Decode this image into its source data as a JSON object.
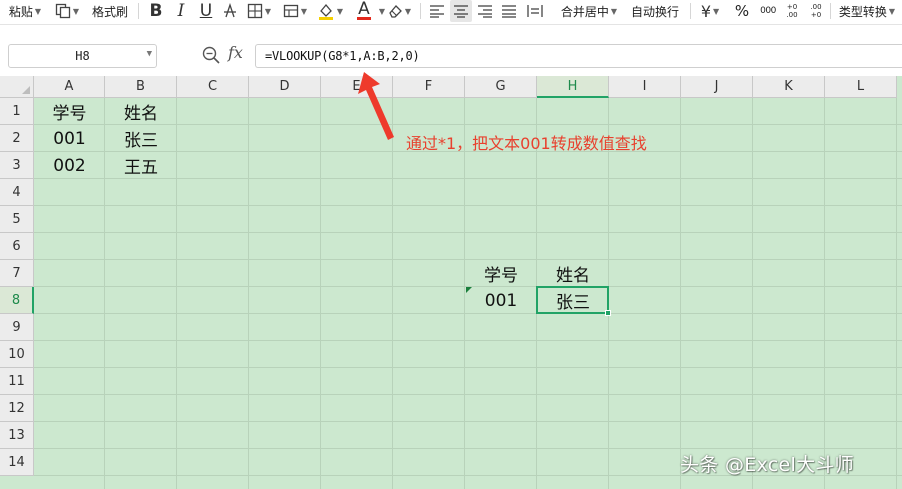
{
  "toolbar": {
    "paste_label": "粘贴",
    "format_painter_label": "格式刷",
    "bold_label": "B",
    "italic_label": "I",
    "underline_label": "U",
    "font_color_label": "A",
    "merge_center_label": "合并居中",
    "wrap_text_label": "自动换行",
    "currency_label": "¥",
    "percent_label": "%",
    "thousands_label": "000",
    "increase_decimal_label": "+0 .00",
    "decrease_decimal_label": ".00 +0",
    "type_convert_label": "类型转换",
    "font_color_hex": "#e3281c",
    "accent_hex": "#21a366"
  },
  "formula_bar": {
    "name_box": "H8",
    "fx_label": "fx",
    "formula": "=VLOOKUP(G8*1,A:B,2,0)"
  },
  "columns": [
    "A",
    "B",
    "C",
    "D",
    "E",
    "F",
    "G",
    "H",
    "I",
    "J",
    "K",
    "L"
  ],
  "rows": [
    "1",
    "2",
    "3",
    "4",
    "5",
    "6",
    "7",
    "8",
    "9",
    "10",
    "11",
    "12",
    "13",
    "14"
  ],
  "active_cell": {
    "column": "H",
    "row": "8"
  },
  "cells": {
    "A1": "学号",
    "B1": "姓名",
    "A2": "001",
    "B2": "张三",
    "A3": "002",
    "B3": "王五",
    "G7": "学号",
    "H7": "姓名",
    "G8": "001",
    "H8": "张三"
  },
  "annotation": {
    "text": "通过*1，把文本001转成数值查找",
    "color": "#e8412e"
  },
  "watermark": "头条 @Excel大斗师",
  "sheet_background": "#cce8cf"
}
